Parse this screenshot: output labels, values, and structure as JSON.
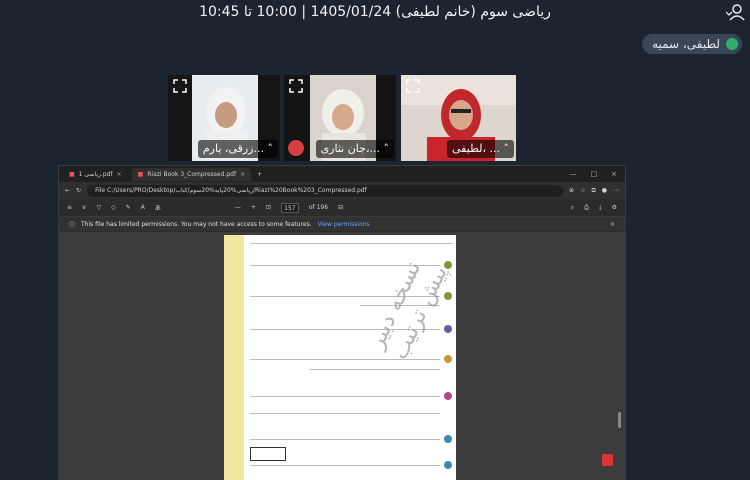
{
  "meeting": {
    "title": "ریاضی سوم (خانم لطیفی) 1405/01/24 | 10:00 تا 10:45"
  },
  "presenter_chip": {
    "name": "لطیفی، سمیه"
  },
  "participants": [
    {
      "name": "زرقی، یارم...",
      "mic_off": false
    },
    {
      "name": "جان نثاری،...",
      "mic_off": true
    },
    {
      "name": "لطیفی، ..."
    }
  ],
  "pdf_viewer": {
    "tabs": [
      {
        "label": "ریاضی 1.pdf"
      },
      {
        "label": "Riazi Book 3_Compressed.pdf"
      }
    ],
    "address": "File   C:/Users/PRO/Desktop/ریاضی%20پایه%20سوم/کتاب/Riazi%20Book%203_Compressed.pdf",
    "page_current": "157",
    "page_total": "of 196",
    "notice": "This file has limited permissions. You may not have access to some features.",
    "notice_link": "View permissions",
    "watermark_line1": "نسخه دبیر",
    "watermark_line2": "پیش ترتیب"
  }
}
